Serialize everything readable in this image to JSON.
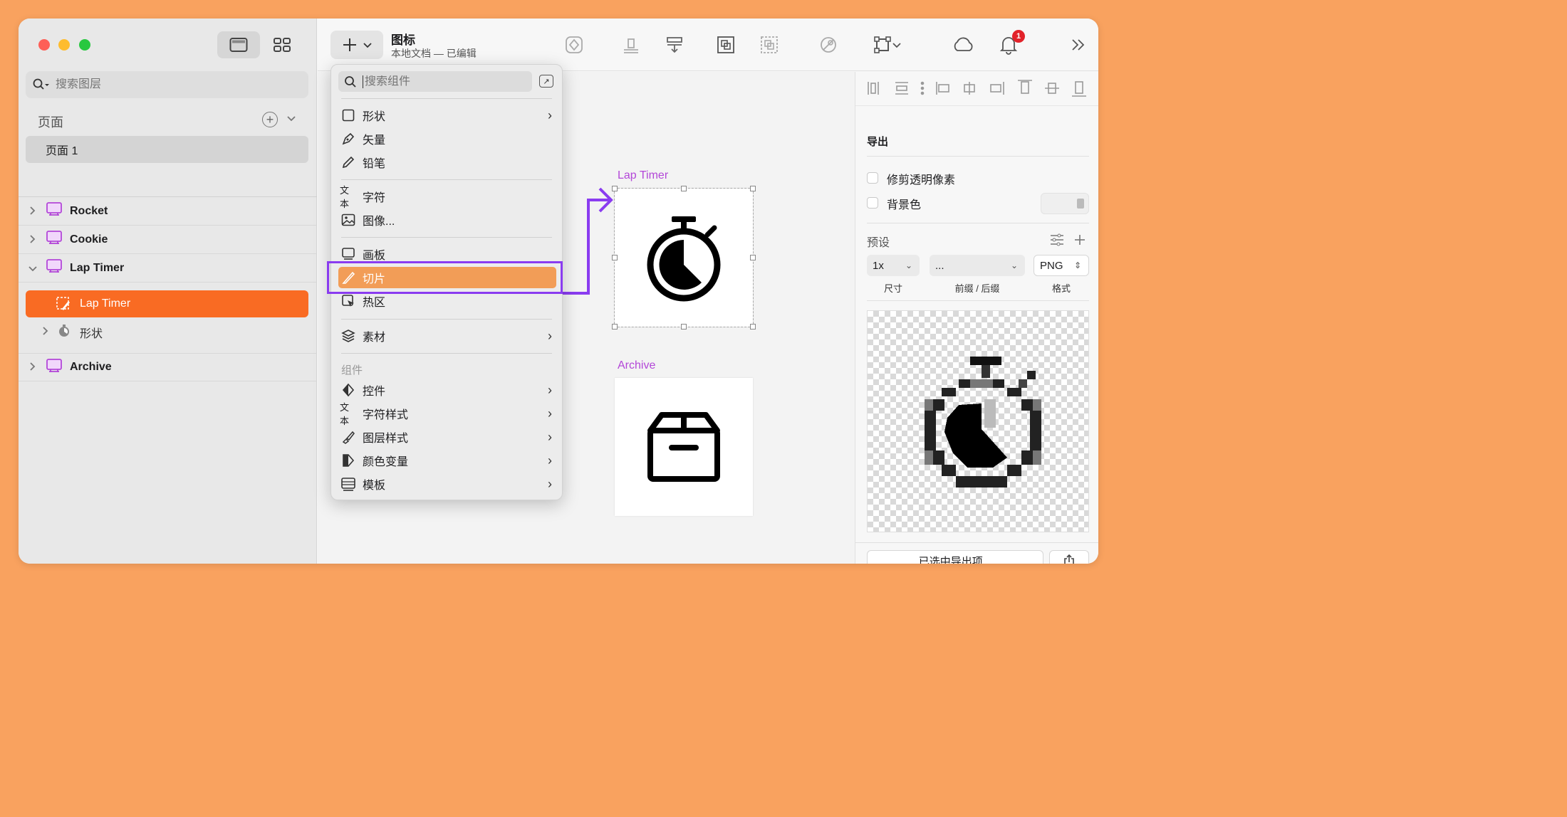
{
  "window": {
    "traffic_colors": [
      "#FE5F57",
      "#FEBC2E",
      "#28C840"
    ]
  },
  "sidebar": {
    "search_placeholder": "搜索图层",
    "pages_label": "页面",
    "pages": [
      {
        "label": "页面 1"
      }
    ],
    "layers": [
      {
        "label": "Rocket",
        "icon": "artboard-icon"
      },
      {
        "label": "Cookie",
        "icon": "artboard-icon"
      },
      {
        "label": "Lap Timer",
        "icon": "artboard-icon",
        "expanded": true
      },
      {
        "label": "Archive",
        "icon": "artboard-icon"
      }
    ],
    "selected_layer": {
      "label": "Lap Timer",
      "icon": "slice-icon"
    },
    "child_layer": {
      "label": "形状",
      "icon": "stopwatch-icon"
    }
  },
  "toolbar": {
    "doc_title": "图标",
    "doc_subtitle": "本地文档 — 已编辑",
    "notification_count": "1"
  },
  "insert_menu": {
    "search_placeholder": "搜索组件",
    "items_group1": [
      {
        "label": "形状",
        "icon": "square-icon",
        "submenu": true
      },
      {
        "label": "矢量",
        "icon": "pen-icon",
        "submenu": false
      },
      {
        "label": "铅笔",
        "icon": "pencil-icon",
        "submenu": false
      }
    ],
    "items_group2": [
      {
        "label": "字符",
        "icon": "text-icon",
        "icon_text": "文本",
        "submenu": false
      },
      {
        "label": "图像...",
        "icon": "image-icon",
        "submenu": false
      }
    ],
    "items_group3": [
      {
        "label": "画板",
        "icon": "artboard-icon",
        "submenu": false
      },
      {
        "label": "切片",
        "icon": "slice-icon",
        "submenu": false,
        "highlighted": true
      },
      {
        "label": "热区",
        "icon": "hotspot-icon",
        "submenu": false
      }
    ],
    "items_group4": [
      {
        "label": "素材",
        "icon": "layers-icon",
        "submenu": true
      }
    ],
    "section_label": "组件",
    "items_group5": [
      {
        "label": "控件",
        "icon": "diamond-icon",
        "submenu": true
      },
      {
        "label": "字符样式",
        "icon": "text-icon",
        "icon_text": "文本",
        "submenu": true
      },
      {
        "label": "图层样式",
        "icon": "brush-icon",
        "submenu": true
      },
      {
        "label": "颜色变量",
        "icon": "color-icon",
        "submenu": true
      },
      {
        "label": "模板",
        "icon": "template-icon",
        "submenu": true
      }
    ]
  },
  "canvas": {
    "artboards": [
      {
        "label": "Lap Timer",
        "icon": "stopwatch-icon"
      },
      {
        "label": "Archive",
        "icon": "archive-box-icon"
      }
    ],
    "label_color": "#B347D8",
    "arrow_color": "#8A3CF0"
  },
  "inspector": {
    "export_heading": "导出",
    "trim_label": "修剪透明像素",
    "trim_checked": false,
    "bg_label": "背景色",
    "bg_checked": false,
    "presets_label": "预设",
    "size_value": "1x",
    "suffix_value": "...",
    "format_value": "PNG",
    "size_caption": "尺寸",
    "suffix_caption": "前缀 / 后缀",
    "format_caption": "格式",
    "export_button": "已选中导出项..."
  },
  "colors": {
    "accent": "#F96B23",
    "frame": "#F9A25F",
    "menu_highlight": "#F29D57"
  }
}
